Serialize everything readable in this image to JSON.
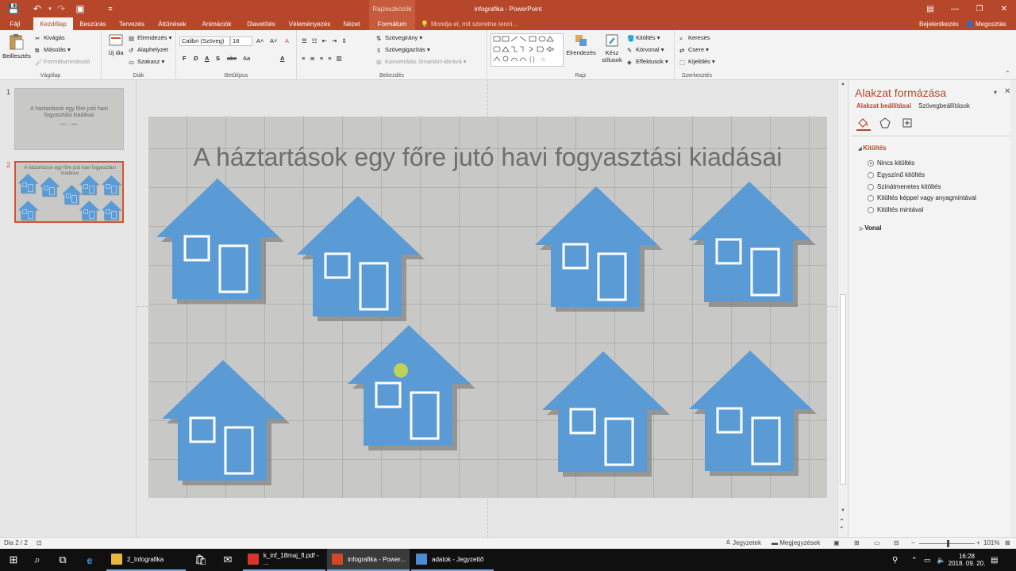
{
  "titlebar": {
    "context_label": "Rajzeszközök",
    "app_title": "infografika - PowerPoint",
    "save_icon": "💾",
    "undo_icon": "↶",
    "redo_icon": "↷",
    "start_icon": "▣",
    "more_icon": "≡",
    "restore_ribbon_icon": "▤",
    "minimize_icon": "—",
    "maximize_icon": "❐",
    "close_icon": "✕"
  },
  "tabs": {
    "file": "Fájl",
    "home": "Kezdőlap",
    "insert": "Beszúrás",
    "design": "Tervezés",
    "transitions": "Áttűnések",
    "animations": "Animációk",
    "slideshow": "Diavetítés",
    "review": "Véleményezés",
    "view": "Nézet",
    "format": "Formátum",
    "tellme": "Mondja el, mit szeretne tenni...",
    "signin": "Bejelentkezés",
    "share": "Megosztás"
  },
  "ribbon": {
    "clipboard": {
      "label": "Vágólap",
      "paste": "Beillesztés",
      "cut": "Kivágás",
      "copy": "Másolás",
      "painter": "Formátummásoló"
    },
    "slides": {
      "label": "Diák",
      "new": "Új dia",
      "layout": "Elrendezés",
      "reset": "Alaphelyzet",
      "section": "Szakasz"
    },
    "font": {
      "label": "Betűtípus",
      "name": "Calibri (Szöveg)",
      "size": "18",
      "bold": "F",
      "italic": "D",
      "underline": "A",
      "strike": "S",
      "spacing": "abc",
      "aa": "Aa",
      "grow": "A˄",
      "shrink": "A˅",
      "clear": "A",
      "color": "A"
    },
    "paragraph": {
      "label": "Bekezdés",
      "direction": "Szövegirány",
      "align": "Szövegigazítás",
      "smartart": "Konvertálás SmartArt-ábrává"
    },
    "drawing": {
      "label": "Rajz",
      "arrange": "Elrendezés",
      "quickstyles": "Kész stílusok",
      "fill": "Kitöltés",
      "outline": "Körvonal",
      "effects": "Effektusok"
    },
    "editing": {
      "label": "Szerkesztés",
      "find": "Keresés",
      "replace": "Csere",
      "select": "Kijelölés"
    }
  },
  "sidebar": {
    "slides": [
      {
        "number": "1",
        "title": "A háztartások egy főre jutó havi fogyasztási kiadásai",
        "sub": "2017. I. félév"
      },
      {
        "number": "2",
        "title": "A háztartások egy főre jutó havi fogyasztási kiadásai"
      }
    ]
  },
  "slide": {
    "title": "A háztartások egy főre jutó havi fogyasztási kiadásai",
    "house_color": "#5b9bd5",
    "background": "#c8c8c6"
  },
  "pane": {
    "title": "Alakzat formázása",
    "tab_shape": "Alakzat beállításai",
    "tab_text": "Szövegbeállítások",
    "fill_section": "Kitöltés",
    "options": [
      {
        "label": "Nincs kitöltés",
        "selected": true
      },
      {
        "label": "Egyszínű kitöltés",
        "selected": false
      },
      {
        "label": "Színátmenetes kitöltés",
        "selected": false
      },
      {
        "label": "Kitöltés képpel vagy anyagmintával",
        "selected": false
      },
      {
        "label": "Kitöltés mintával",
        "selected": false
      }
    ],
    "line_section": "Vonal"
  },
  "statusbar": {
    "slide_info": "Dia 2 / 2",
    "notes": "Jegyzetek",
    "comments": "Megjegyzések",
    "zoom": "101%",
    "zoom_fraction": 0.51
  },
  "taskbar": {
    "apps": [
      {
        "label": "2_Infografika",
        "color": "#e8b83a"
      },
      {
        "label": "k_inf_18maj_fl.pdf - ...",
        "color": "#d9342b"
      },
      {
        "label": "infografika - Power...",
        "color": "#d24726"
      },
      {
        "label": "adatok - Jegyzettő",
        "color": "#4a8bd8"
      }
    ],
    "time": "16:28",
    "date": "2018. 09. 20."
  },
  "accent": "#b7472a"
}
